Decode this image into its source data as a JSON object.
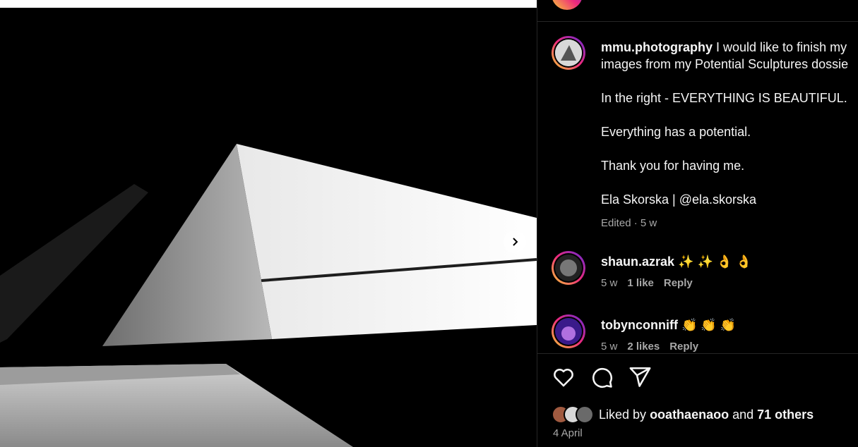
{
  "post": {
    "image_alt": "black and white photo of a concrete pyramid shape",
    "author": "mmu.photography",
    "caption_lines": [
      "I would like to finish my",
      "images from my Potential Sculptures dossie",
      "In the right - EVERYTHING IS BEAUTIFUL.",
      "Everything has a potential.",
      "Thank you for having me.",
      "Ela Skorska | @ela.skorska"
    ],
    "edited_meta": "Edited · 5 w"
  },
  "comments": [
    {
      "user": "shaun.azrak",
      "text": "✨ ✨ 👌 👌",
      "age": "5 w",
      "likes": "1 like",
      "reply": "Reply"
    },
    {
      "user": "tobynconniff",
      "text": "👏 👏 👏",
      "age": "5 w",
      "likes": "2 likes",
      "reply": "Reply"
    }
  ],
  "likes": {
    "prefix": "Liked by",
    "user": "ooathaenaoo",
    "and": "and",
    "others": "71 others"
  },
  "date": "4 April",
  "icons": [
    "heart-icon",
    "comment-icon",
    "share-icon",
    "chevron-right-icon"
  ],
  "colors": {
    "background": "#000000",
    "text": "#f5f5f5",
    "muted": "#a8a8a8",
    "divider": "#262626"
  }
}
